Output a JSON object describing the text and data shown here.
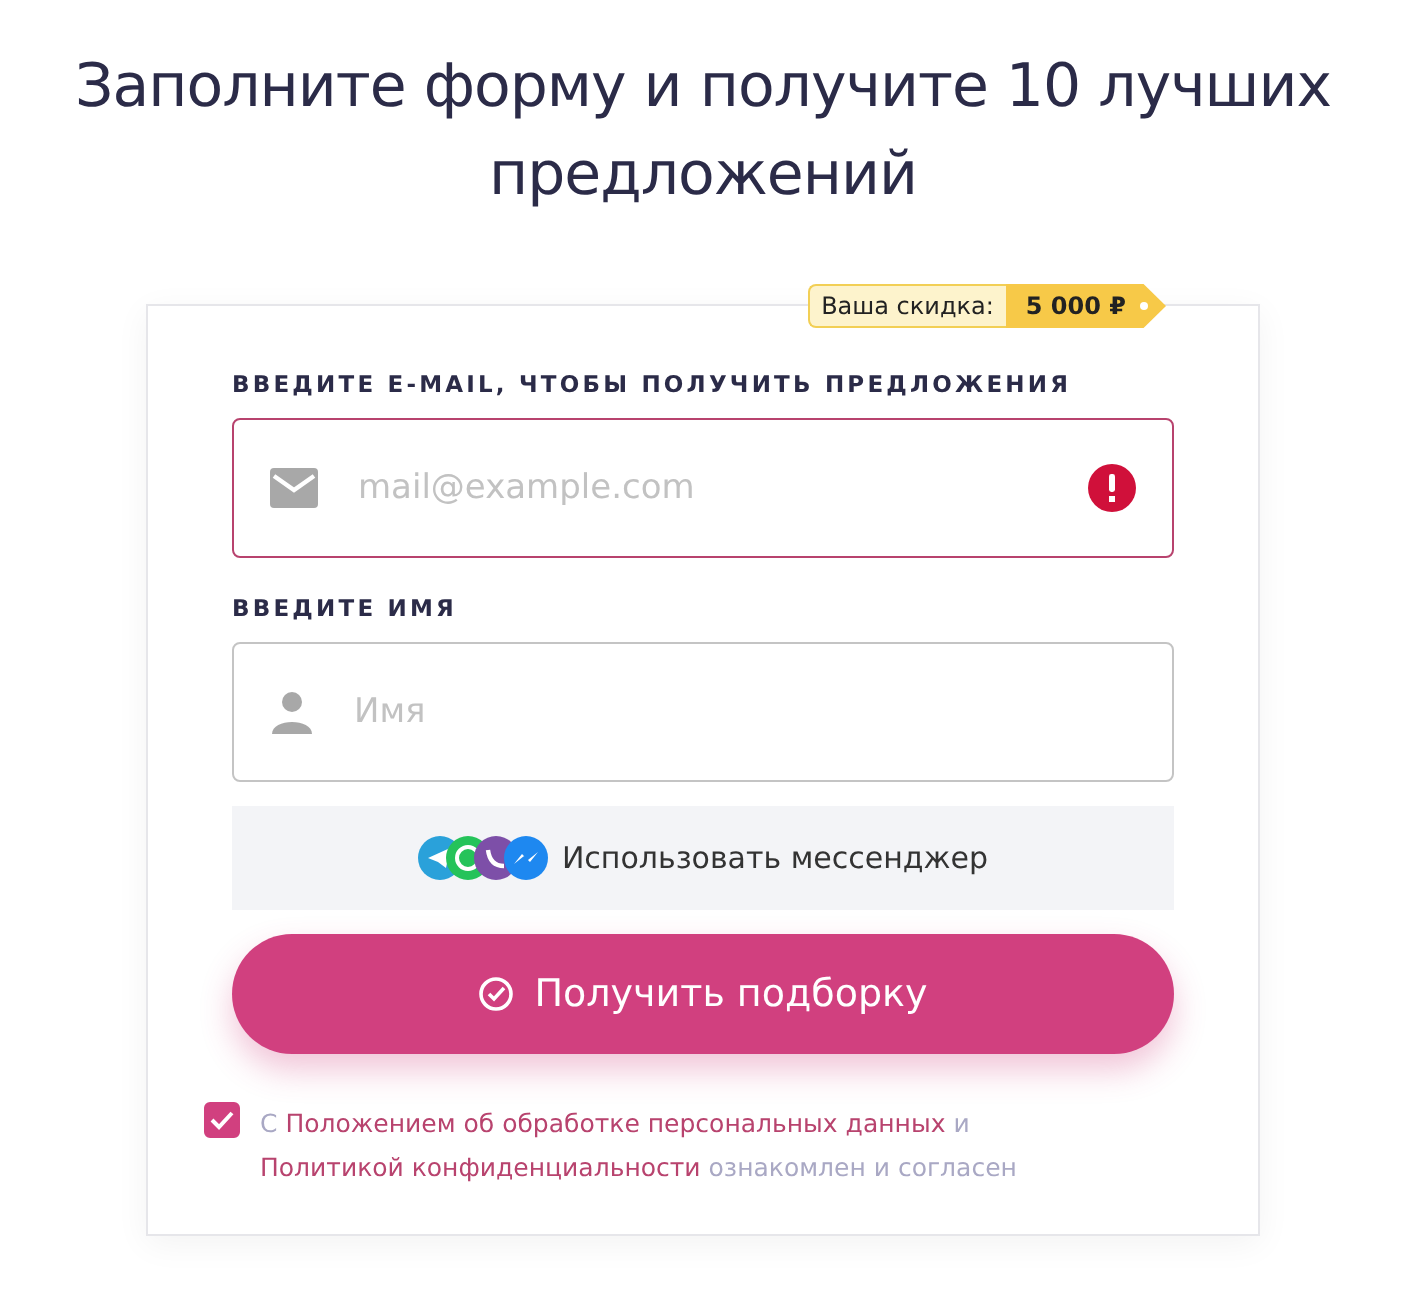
{
  "title": "Заполните форму и получите 10 лучших предложений",
  "discount": {
    "label": "Ваша скидка:",
    "value": "5 000 ₽"
  },
  "fields": [
    {
      "kind": "email",
      "label": "ВВЕДИТЕ E-MAIL, ЧТОБЫ ПОЛУЧИТЬ ПРЕДЛОЖЕНИЯ",
      "placeholder": "mail@example.com",
      "error": true
    },
    {
      "kind": "name",
      "label": "ВВЕДИТЕ ИМЯ",
      "placeholder": "Имя",
      "error": false
    }
  ],
  "messenger_button": "Использовать мессенджер",
  "submit_button": "Получить подборку",
  "consent": {
    "checked": true,
    "parts": [
      {
        "kind": "text",
        "text": "С"
      },
      {
        "kind": "link",
        "text": "Положением об обработке персональных данных"
      },
      {
        "kind": "text",
        "text": "и"
      },
      {
        "kind": "link",
        "text": "Политикой конфиденциальности"
      },
      {
        "kind": "text",
        "text": "ознакомлен и согласен"
      }
    ]
  }
}
